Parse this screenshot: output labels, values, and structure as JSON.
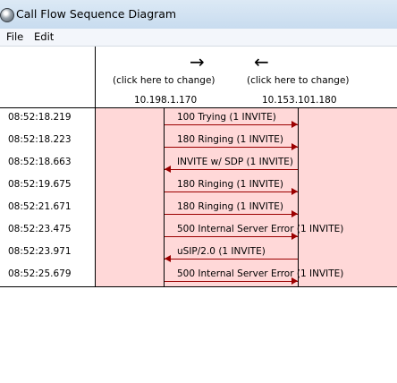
{
  "window": {
    "title": "Call Flow Sequence Diagram"
  },
  "menu": {
    "file": "File",
    "edit": "Edit"
  },
  "header": {
    "left_arrow": "→",
    "right_arrow": "←",
    "left_hint": "(click here to change)",
    "right_hint": "(click here to change)",
    "left_ip": "10.198.1.170",
    "right_ip": "10.153.101.180"
  },
  "rows": [
    {
      "time": "08:52:18.219",
      "message": "100 Trying (1 INVITE)",
      "direction": "right"
    },
    {
      "time": "08:52:18.223",
      "message": "180 Ringing (1 INVITE)",
      "direction": "right"
    },
    {
      "time": "08:52:18.663",
      "message": "INVITE w/ SDP (1 INVITE)",
      "direction": "left"
    },
    {
      "time": "08:52:19.675",
      "message": "180 Ringing (1 INVITE)",
      "direction": "right"
    },
    {
      "time": "08:52:21.671",
      "message": "180 Ringing (1 INVITE)",
      "direction": "right"
    },
    {
      "time": "08:52:23.475",
      "message": "500 Internal Server Error (1 INVITE)",
      "direction": "right"
    },
    {
      "time": "08:52:23.971",
      "message": "uSIP/2.0 (1 INVITE)",
      "direction": "left"
    },
    {
      "time": "08:52:25.679",
      "message": "500 Internal Server Error (1 INVITE)",
      "direction": "right"
    }
  ],
  "colors": {
    "diagram_bg": "#ffd8d8",
    "arrow": "#9b0000"
  },
  "icons": {
    "app": "globe-icon"
  }
}
